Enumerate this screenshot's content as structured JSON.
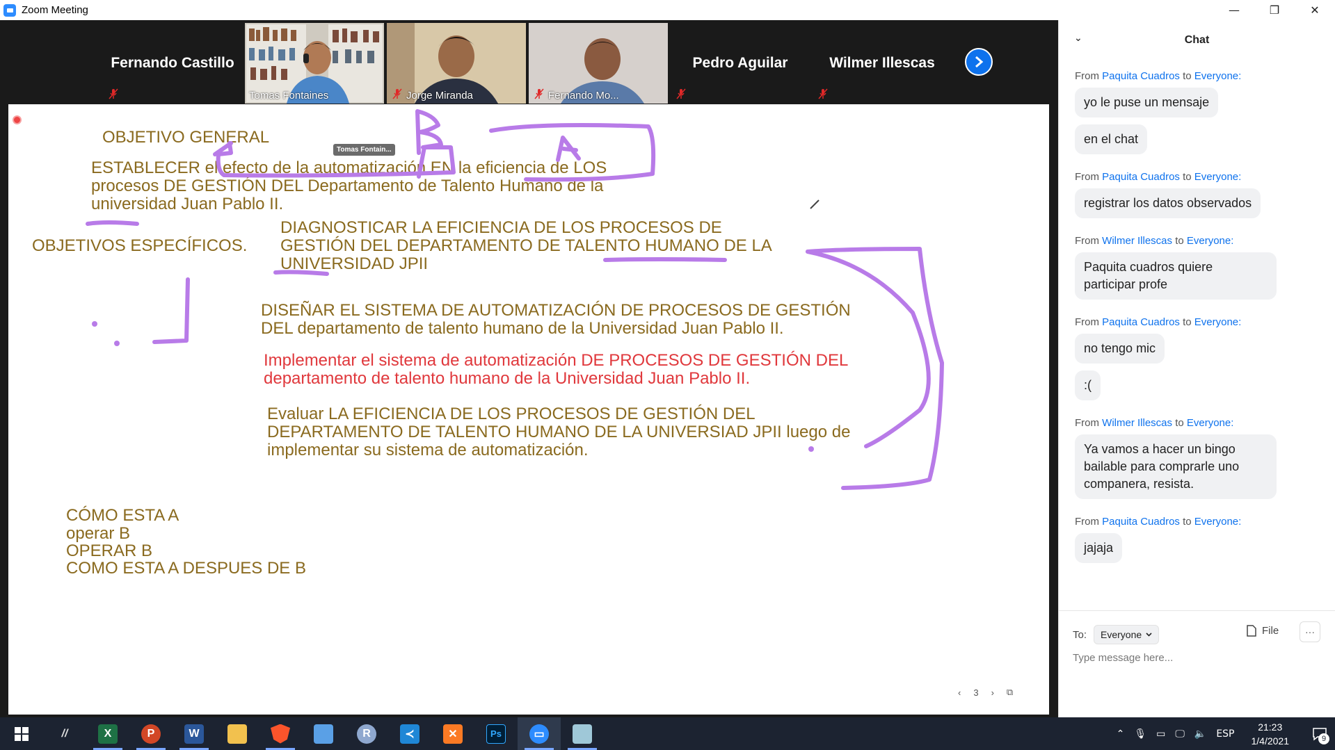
{
  "window": {
    "title": "Zoom Meeting",
    "minimize": "—",
    "restore": "❐",
    "close": "✕"
  },
  "participants": [
    {
      "name": "Fernando Castillo",
      "video": false,
      "muted": true
    },
    {
      "name": "Tomas Fontaines",
      "video": true,
      "muted": false,
      "active_speaker": true
    },
    {
      "name": "Jorge Miranda",
      "video": true,
      "muted": true
    },
    {
      "name": "Fernando Mo...",
      "video": true,
      "muted": true
    },
    {
      "name": "Pedro Aguilar",
      "video": false,
      "muted": true
    },
    {
      "name": "Wilmer Illescas",
      "video": false,
      "muted": true
    }
  ],
  "whiteboard": {
    "annotator_tag": "Tomas Fontain...",
    "lines": {
      "objetivo_general": "OBJETIVO GENERAL",
      "og_line1": "ESTABLECER  el efecto de la automatización EN la eficiencia de LOS",
      "og_line2": "procesos DE GESTIÓN DEL  Departamento de Talento Humano de la",
      "og_line3": "universidad Juan Pablo II.",
      "objetivos_especificos": "OBJETIVOS ESPECÍFICOS.",
      "oe1_line1": "DIAGNOSTICAR LA EFICIENCIA DE LOS PROCESOS DE",
      "oe1_line2": "GESTIÓN  DEL DEPARTAMENTO DE TALENTO HUMANO DE LA",
      "oe1_line3": "UNIVERSIDAD  JPII",
      "oe2_line1": "DISEÑAR EL SISTEMA DE AUTOMATIZACIÓN DE PROCESOS DE GESTIÓN",
      "oe2_line2": "DEL departamento de talento humano de la Universidad Juan Pablo II.",
      "oe3_line1": "Implementar el sistema de automatización DE PROCESOS DE GESTIÓN DEL",
      "oe3_line2": "departamento de talento humano de la Universidad Juan Pablo II.",
      "oe4_line1": "Evaluar LA EFICIENCIA DE LOS PROCESOS DE GESTIÓN  DEL",
      "oe4_line2": "DEPARTAMENTO DE TALENTO HUMANO DE LA UNIVERSIAD  JPII luego de",
      "oe4_line3": "implementar su sistema de automatización.",
      "notes1": "CÓMO ESTA A",
      "notes2": "operar B",
      "notes3": "OPERAR B",
      "notes4": "COMO ESTA A DESPUES DE B"
    },
    "page_number": "3"
  },
  "chat": {
    "title": "Chat",
    "messages": [
      {
        "sender": "Paquita Cuadros",
        "recipient": "Everyone:",
        "texts": [
          "yo le puse un mensaje",
          "en el chat"
        ]
      },
      {
        "sender": "Paquita Cuadros",
        "recipient": "Everyone:",
        "texts": [
          "registrar los datos observados"
        ]
      },
      {
        "sender": "Wilmer Illescas",
        "recipient": "Everyone:",
        "texts": [
          "Paquita cuadros quiere participar profe"
        ]
      },
      {
        "sender": "Paquita Cuadros",
        "recipient": "Everyone:",
        "texts": [
          "no tengo mic",
          ":("
        ]
      },
      {
        "sender": "Wilmer Illescas",
        "recipient": "Everyone:",
        "texts": [
          "Ya vamos a hacer un bingo bailable para comprarle uno companera, resista."
        ]
      },
      {
        "sender": "Paquita Cuadros",
        "recipient": "Everyone:",
        "texts": [
          "jajaja"
        ]
      }
    ],
    "from_word": "From",
    "to_word": "to",
    "to_label": "To:",
    "to_value": "Everyone",
    "file_label": "File",
    "more_label": "···",
    "input_placeholder": "Type message here..."
  },
  "taskbar": {
    "apps": [
      "start",
      "app-m",
      "excel",
      "powerpoint",
      "word",
      "file-explorer",
      "brave",
      "control-panel",
      "r",
      "vscode",
      "xampp",
      "photoshop",
      "zoom",
      "notepad"
    ],
    "language": "ESP",
    "time": "21:23",
    "date": "1/4/2021",
    "notification_count": "9"
  }
}
